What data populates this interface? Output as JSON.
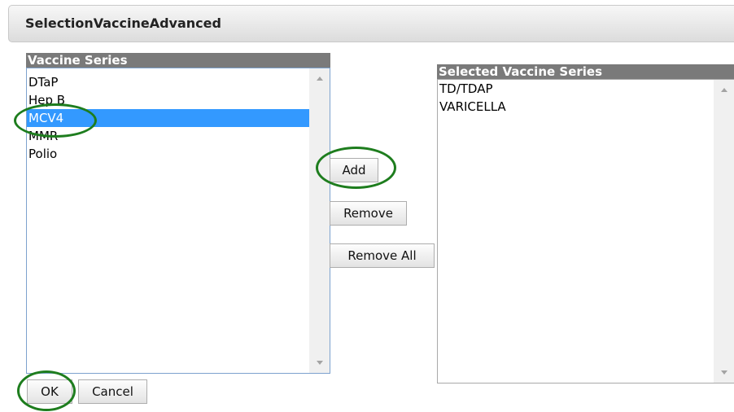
{
  "header": {
    "title": "SelectionVaccineAdvanced"
  },
  "available": {
    "label": "Vaccine Series",
    "items": [
      "DTaP",
      "Hep B",
      "MCV4",
      "MMR",
      "Polio"
    ],
    "selected_item": "MCV4"
  },
  "selected": {
    "label": "Selected Vaccine Series",
    "items": [
      "TD/TDAP",
      "VARICELLA"
    ]
  },
  "buttons": {
    "add": "Add",
    "remove": "Remove",
    "remove_all": "Remove All",
    "ok": "OK",
    "cancel": "Cancel"
  },
  "colors": {
    "highlight_ring": "#1e7d1e",
    "selection": "#3399ff",
    "label_bar": "#7a7a7a"
  }
}
